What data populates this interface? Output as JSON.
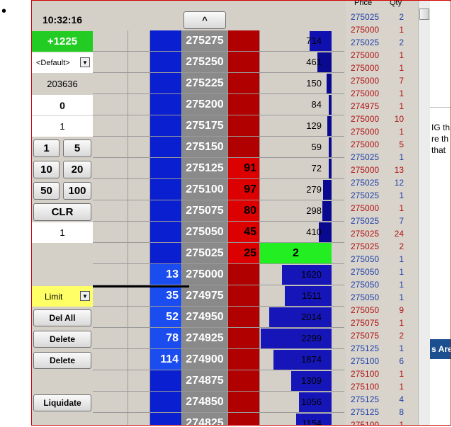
{
  "bullet": "•",
  "clock": "10:32:16",
  "up_button": "^",
  "position": "+1225",
  "account": "<Default>",
  "account_id": "203636",
  "fields": [
    "0",
    "1"
  ],
  "qty_buttons": [
    "1",
    "5",
    "10",
    "20",
    "50",
    "100"
  ],
  "clr_label": "CLR",
  "qty_value": "1",
  "order_type": "Limit",
  "actions": {
    "del_all": "Del All",
    "delete1": "Delete",
    "delete2": "Delete",
    "liquidate": "Liquidate"
  },
  "colors": {
    "bid": "#0a1fd0",
    "ask": "#b00000",
    "position": "#22cc22",
    "limit": "#ffff66",
    "last": "#22ee22"
  },
  "ladder": [
    {
      "price": "275275",
      "buy": "",
      "sell": "",
      "vol": "714",
      "volpct": 0.31
    },
    {
      "price": "275250",
      "buy": "",
      "sell": "",
      "vol": "461",
      "volpct": 0.2
    },
    {
      "price": "275225",
      "buy": "",
      "sell": "",
      "vol": "150",
      "volpct": 0.065
    },
    {
      "price": "275200",
      "buy": "",
      "sell": "",
      "vol": "84",
      "volpct": 0.037
    },
    {
      "price": "275175",
      "buy": "",
      "sell": "",
      "vol": "129",
      "volpct": 0.056
    },
    {
      "price": "275150",
      "buy": "",
      "sell": "",
      "vol": "59",
      "volpct": 0.026
    },
    {
      "price": "275125",
      "buy": "",
      "sell": "91",
      "vol": "72",
      "volpct": 0.031
    },
    {
      "price": "275100",
      "buy": "",
      "sell": "97",
      "vol": "279",
      "volpct": 0.12
    },
    {
      "price": "275075",
      "buy": "",
      "sell": "80",
      "vol": "298",
      "volpct": 0.13
    },
    {
      "price": "275050",
      "buy": "",
      "sell": "45",
      "vol": "410",
      "volpct": 0.18
    },
    {
      "price": "275025",
      "buy": "",
      "sell": "25",
      "vol": "2",
      "volpct": 0,
      "last": true
    },
    {
      "price": "275000",
      "buy": "13",
      "sell": "",
      "vol": "1620",
      "volpct": 0.7
    },
    {
      "price": "274975",
      "buy": "35",
      "sell": "",
      "vol": "1511",
      "volpct": 0.66
    },
    {
      "price": "274950",
      "buy": "52",
      "sell": "",
      "vol": "2014",
      "volpct": 0.88
    },
    {
      "price": "274925",
      "buy": "78",
      "sell": "",
      "vol": "2299",
      "volpct": 1.0
    },
    {
      "price": "274900",
      "buy": "114",
      "sell": "",
      "vol": "1874",
      "volpct": 0.82
    },
    {
      "price": "274875",
      "buy": "",
      "sell": "",
      "vol": "1309",
      "volpct": 0.57
    },
    {
      "price": "274850",
      "buy": "",
      "sell": "",
      "vol": "1056",
      "volpct": 0.46
    },
    {
      "price": "274825",
      "buy": "",
      "sell": "",
      "vol": "1154",
      "volpct": 0.5
    }
  ],
  "tns_header": {
    "price": "Price",
    "qty": "Qty"
  },
  "tns": [
    {
      "p": "275025",
      "q": "2",
      "c": "blue"
    },
    {
      "p": "275000",
      "q": "1",
      "c": "red"
    },
    {
      "p": "275025",
      "q": "2",
      "c": "blue"
    },
    {
      "p": "275000",
      "q": "1",
      "c": "red"
    },
    {
      "p": "275000",
      "q": "1",
      "c": "red"
    },
    {
      "p": "275000",
      "q": "7",
      "c": "red"
    },
    {
      "p": "275000",
      "q": "1",
      "c": "red"
    },
    {
      "p": "274975",
      "q": "1",
      "c": "red"
    },
    {
      "p": "275000",
      "q": "10",
      "c": "red"
    },
    {
      "p": "275000",
      "q": "1",
      "c": "red"
    },
    {
      "p": "275000",
      "q": "5",
      "c": "red"
    },
    {
      "p": "275025",
      "q": "1",
      "c": "blue"
    },
    {
      "p": "275000",
      "q": "13",
      "c": "red"
    },
    {
      "p": "275025",
      "q": "12",
      "c": "blue"
    },
    {
      "p": "275025",
      "q": "1",
      "c": "blue"
    },
    {
      "p": "275000",
      "q": "1",
      "c": "red"
    },
    {
      "p": "275025",
      "q": "7",
      "c": "blue"
    },
    {
      "p": "275025",
      "q": "24",
      "c": "red"
    },
    {
      "p": "275025",
      "q": "2",
      "c": "red"
    },
    {
      "p": "275050",
      "q": "1",
      "c": "blue"
    },
    {
      "p": "275050",
      "q": "1",
      "c": "blue"
    },
    {
      "p": "275050",
      "q": "1",
      "c": "blue"
    },
    {
      "p": "275050",
      "q": "1",
      "c": "blue"
    },
    {
      "p": "275050",
      "q": "9",
      "c": "red"
    },
    {
      "p": "275075",
      "q": "1",
      "c": "red"
    },
    {
      "p": "275075",
      "q": "2",
      "c": "red"
    },
    {
      "p": "275125",
      "q": "1",
      "c": "blue"
    },
    {
      "p": "275100",
      "q": "6",
      "c": "blue"
    },
    {
      "p": "275100",
      "q": "1",
      "c": "red"
    },
    {
      "p": "275100",
      "q": "1",
      "c": "red"
    },
    {
      "p": "275125",
      "q": "4",
      "c": "blue"
    },
    {
      "p": "275125",
      "q": "8",
      "c": "blue"
    },
    {
      "p": "275100",
      "q": "1",
      "c": "red"
    },
    {
      "p": "275125",
      "q": "1",
      "c": "blue"
    }
  ],
  "background_text": [
    "IG th",
    "re th",
    "that",
    "s Are"
  ]
}
